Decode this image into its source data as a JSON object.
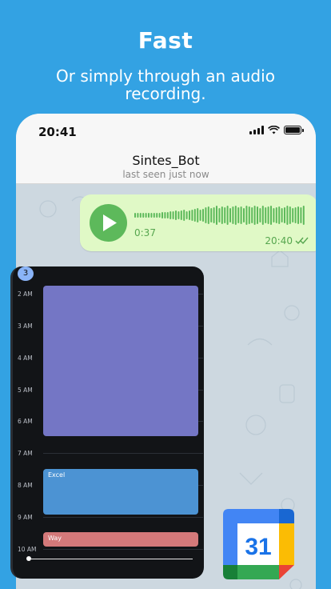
{
  "hero": {
    "title": "Fast",
    "subtitle": "Or simply through an audio recording."
  },
  "status_bar": {
    "time": "20:41"
  },
  "chat": {
    "name": "Sintes_Bot",
    "status": "last seen just now"
  },
  "voice_message": {
    "duration": "0:37",
    "time": "20:40",
    "read": true
  },
  "calendar": {
    "badge": "3",
    "hours": [
      "2 AM",
      "3 AM",
      "4 AM",
      "5 AM",
      "6 AM",
      "7 AM",
      "8 AM",
      "9 AM",
      "10 AM"
    ],
    "events": [
      {
        "title": "",
        "color": "#7476c5"
      },
      {
        "title": "Excel",
        "color": "#4c93d3"
      },
      {
        "title": "Way",
        "color": "#d4797a"
      }
    ]
  },
  "app_icon": {
    "name": "google-calendar-icon",
    "day": "31"
  },
  "colors": {
    "background": "#33a2e3",
    "bubble": "#e0f9c6",
    "accent_green": "#5db95b"
  }
}
